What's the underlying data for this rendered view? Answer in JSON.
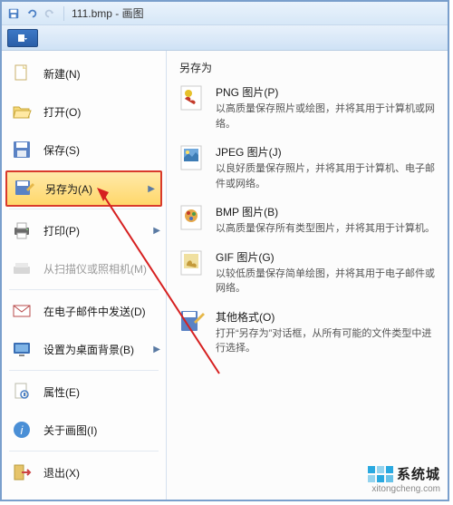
{
  "titlebar": {
    "filename": "111.bmp",
    "appname": "画图"
  },
  "menu": {
    "new": "新建(N)",
    "open": "打开(O)",
    "save": "保存(S)",
    "saveas": "另存为(A)",
    "print": "打印(P)",
    "scanner": "从扫描仪或照相机(M)",
    "email": "在电子邮件中发送(D)",
    "wallpaper": "设置为桌面背景(B)",
    "properties": "属性(E)",
    "about": "关于画图(I)",
    "exit": "退出(X)"
  },
  "right": {
    "title": "另存为",
    "png": {
      "label": "PNG 图片(P)",
      "desc": "以高质量保存照片或绘图，并将其用于计算机或网络。"
    },
    "jpeg": {
      "label": "JPEG 图片(J)",
      "desc": "以良好质量保存照片，并将其用于计算机、电子邮件或网络。"
    },
    "bmp": {
      "label": "BMP 图片(B)",
      "desc": "以高质量保存所有类型图片，并将其用于计算机。"
    },
    "gif": {
      "label": "GIF 图片(G)",
      "desc": "以较低质量保存简单绘图，并将其用于电子邮件或网络。"
    },
    "other": {
      "label": "其他格式(O)",
      "desc": "打开“另存为”对话框，从所有可能的文件类型中进行选择。"
    }
  },
  "watermark": {
    "brand": "系统城",
    "url": "xitongcheng.com"
  }
}
